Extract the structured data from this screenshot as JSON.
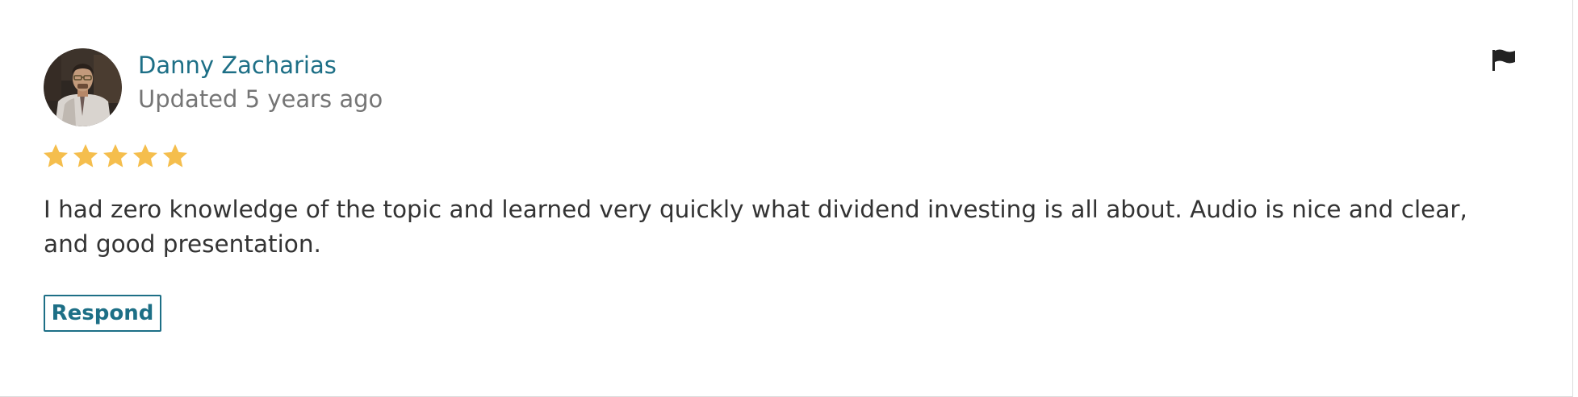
{
  "review": {
    "author_name": "Danny Zacharias",
    "updated_text": "Updated 5 years ago",
    "rating": 5,
    "rating_max": 5,
    "body": "I had zero knowledge of the topic and learned very quickly what dividend investing is all about. Audio is nice and clear, and good presentation.",
    "respond_label": "Respond",
    "avatar_icon": "user-photo",
    "flag_icon": "flag-icon"
  },
  "colors": {
    "link": "#1d6f86",
    "muted": "#757575",
    "text": "#333333",
    "star": "#f5be4d"
  }
}
